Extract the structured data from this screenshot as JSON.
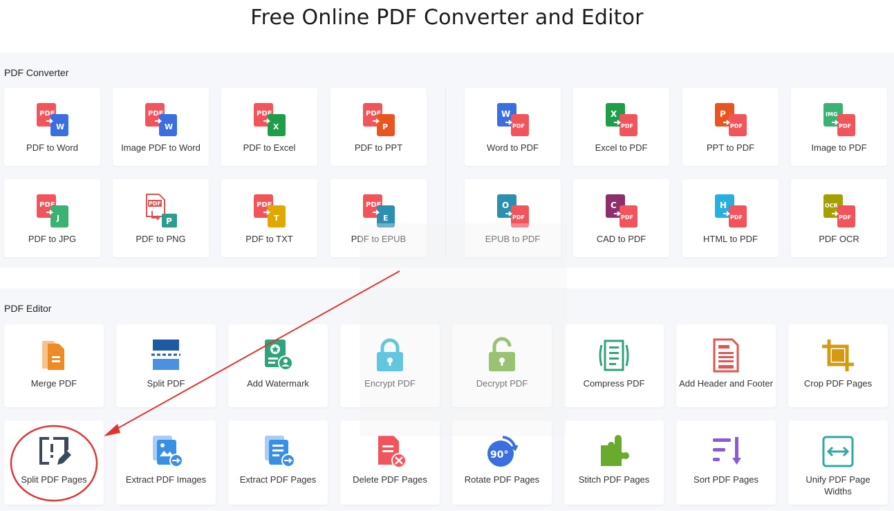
{
  "page": {
    "title": "Free Online PDF Converter and Editor"
  },
  "converter": {
    "label": "PDF Converter",
    "items": [
      {
        "label": "PDF to Word",
        "icon": "pdf-to-word-icon"
      },
      {
        "label": "Image PDF to Word",
        "icon": "image-pdf-to-word-icon"
      },
      {
        "label": "PDF to Excel",
        "icon": "pdf-to-excel-icon"
      },
      {
        "label": "PDF to PPT",
        "icon": "pdf-to-ppt-icon"
      },
      {
        "label": "Word to PDF",
        "icon": "word-to-pdf-icon"
      },
      {
        "label": "Excel to PDF",
        "icon": "excel-to-pdf-icon"
      },
      {
        "label": "PPT to PDF",
        "icon": "ppt-to-pdf-icon"
      },
      {
        "label": "Image to PDF",
        "icon": "image-to-pdf-icon"
      },
      {
        "label": "PDF to JPG",
        "icon": "pdf-to-jpg-icon"
      },
      {
        "label": "PDF to PNG",
        "icon": "pdf-to-png-icon"
      },
      {
        "label": "PDF to TXT",
        "icon": "pdf-to-txt-icon"
      },
      {
        "label": "PDF to EPUB",
        "icon": "pdf-to-epub-icon"
      },
      {
        "label": "EPUB to PDF",
        "icon": "epub-to-pdf-icon"
      },
      {
        "label": "CAD to PDF",
        "icon": "cad-to-pdf-icon"
      },
      {
        "label": "HTML to PDF",
        "icon": "html-to-pdf-icon"
      },
      {
        "label": "PDF OCR",
        "icon": "pdf-ocr-icon"
      }
    ]
  },
  "editor": {
    "label": "PDF Editor",
    "items": [
      {
        "label": "Merge PDF",
        "icon": "merge-icon"
      },
      {
        "label": "Split PDF",
        "icon": "split-icon"
      },
      {
        "label": "Add Watermark",
        "icon": "watermark-icon"
      },
      {
        "label": "Encrypt PDF",
        "icon": "lock-icon"
      },
      {
        "label": "Decrypt PDF",
        "icon": "unlock-icon"
      },
      {
        "label": "Compress PDF",
        "icon": "compress-icon"
      },
      {
        "label": "Add Header and Footer",
        "icon": "header-footer-icon"
      },
      {
        "label": "Crop PDF Pages",
        "icon": "crop-icon"
      },
      {
        "label": "Split PDF Pages",
        "icon": "split-pages-icon"
      },
      {
        "label": "Extract PDF Images",
        "icon": "extract-images-icon"
      },
      {
        "label": "Extract PDF Pages",
        "icon": "extract-pages-icon"
      },
      {
        "label": "Delete PDF Pages",
        "icon": "delete-pages-icon"
      },
      {
        "label": "Rotate PDF Pages",
        "icon": "rotate-icon"
      },
      {
        "label": "Stitch PDF Pages",
        "icon": "puzzle-icon"
      },
      {
        "label": "Sort PDF Pages",
        "icon": "sort-icon"
      },
      {
        "label": "Unify PDF Page Widths",
        "icon": "unify-width-icon"
      }
    ]
  },
  "icon_text": {
    "pdf": "PDF",
    "w": "W",
    "x": "X",
    "p": "P",
    "j": "J",
    "t": "T",
    "e": "E",
    "o": "O",
    "c": "C",
    "h": "H",
    "img": "IMG",
    "ocr": "OCR",
    "rot": "90°"
  },
  "colors": {
    "pdf_red": "#f2545b",
    "word_blue": "#3b6fe0",
    "excel_green": "#1f9e49",
    "ppt_orange": "#e8551f",
    "img_green": "#3bb273",
    "jpg_green": "#3bb273",
    "png_teal": "#2a9d8f",
    "txt_yellow": "#e0a800",
    "epub_teal": "#2a8fb0",
    "cad_purple": "#8e2f6b",
    "html_cyan": "#29aee0",
    "ocr_olive": "#a3a000",
    "annotation_red": "#e0342f"
  }
}
